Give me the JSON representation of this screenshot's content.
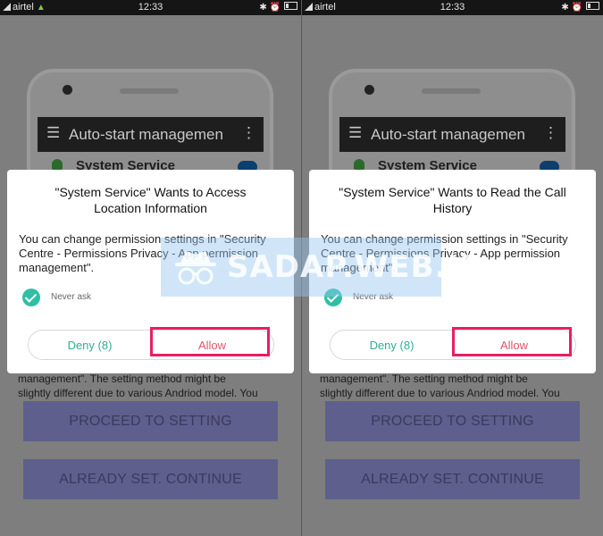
{
  "status_bar": {
    "carrier": "airtel",
    "time": "12:33"
  },
  "app_bar": {
    "title": "Auto-start managemen"
  },
  "background_item": "System Service",
  "background_text": [
    "management\". The setting method might be",
    "slightly different due to various Andriod model. You"
  ],
  "buttons": {
    "proceed": "PROCEED TO SETTING",
    "already": "ALREADY SET. CONTINUE"
  },
  "dialogs": [
    {
      "title_line1": "\"System Service\"  Wants to Access",
      "title_line2": "Location Information",
      "body": "You can change permission settings in \"Security Centre - Permissions Privacy - App permission management\".",
      "never_ask": "Never ask",
      "deny": "Deny (8)",
      "allow": "Allow"
    },
    {
      "title_line1": "\"System Service\"  Wants to Read the Call",
      "title_line2": "History",
      "body": "You can change permission settings in \"Security Centre - Permissions Privacy - App permission management\".",
      "never_ask": "Never ask",
      "deny": "Deny (8)",
      "allow": "Allow"
    }
  ],
  "watermark": {
    "text": "SADAP.WEB.ID"
  },
  "colors": {
    "accent": "#2fbfa4",
    "allow": "#e0556a",
    "highlight": "#e91e63",
    "button_bg": "#5f5f8e"
  },
  "icons": [
    "android-icon",
    "bluetooth-icon",
    "alarm-icon",
    "battery-icon",
    "menu-icon",
    "more-vert-icon",
    "check-circle-icon",
    "spy-icon"
  ]
}
